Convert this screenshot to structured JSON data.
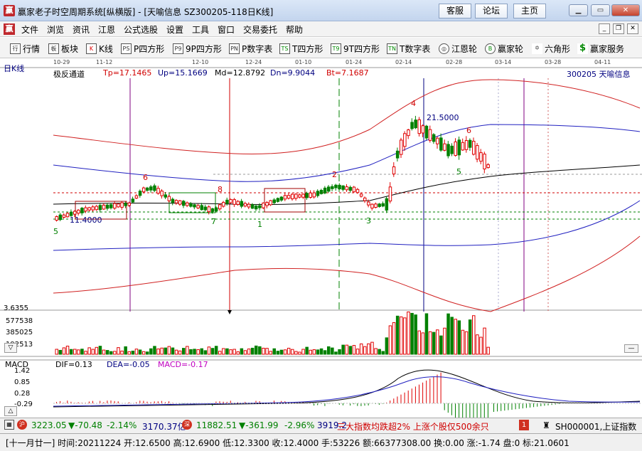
{
  "window": {
    "title": "赢家老子时空周期系统[纵横版] - [天喻信息  SZ300205-118日K线]",
    "app_icon": "赢",
    "top_buttons": [
      "客服",
      "论坛",
      "主页"
    ]
  },
  "menu": {
    "items": [
      "文件",
      "浏览",
      "资讯",
      "江恩",
      "公式选股",
      "设置",
      "工具",
      "窗口",
      "交易委托",
      "帮助"
    ]
  },
  "toolbar": {
    "items": [
      {
        "icon": "行",
        "label": "行情"
      },
      {
        "icon": "板",
        "label": "板块"
      },
      {
        "icon": "K",
        "label": "K线"
      },
      {
        "icon": "PS",
        "label": "P四方形"
      },
      {
        "icon": "P9",
        "label": "9P四方形"
      },
      {
        "icon": "PN",
        "label": "P数字表"
      },
      {
        "icon": "TS",
        "label": "T四方形"
      },
      {
        "icon": "T9",
        "label": "9T四方形"
      },
      {
        "icon": "TN",
        "label": "T数字表"
      },
      {
        "icon": "◎",
        "label": "江恩轮"
      },
      {
        "icon": "B",
        "label": "赢家轮"
      },
      {
        "icon": "✡",
        "label": "六角形"
      },
      {
        "icon": "$",
        "label": "赢家服务"
      }
    ]
  },
  "chart_header": {
    "period": "日K线",
    "dates": [
      "10-29",
      "11-12",
      "12-10",
      "12-24",
      "01-10",
      "01-24",
      "02-14",
      "02-28",
      "03-14",
      "03-28",
      "04-11"
    ],
    "indicator": "极反通道",
    "tp": "Tp=17.1465",
    "up": "Up=15.1669",
    "md": "Md=12.8792",
    "dn": "Dn=9.9044",
    "bt": "Bt=7.1687",
    "stock": "300205  天喻信息"
  },
  "annotations": {
    "high_price": "21.5000",
    "low_price": "11.4000",
    "wave_labels": [
      "5",
      "6",
      "8",
      "7",
      "1",
      "2",
      "3",
      "4",
      "6",
      "5"
    ]
  },
  "volume": {
    "top": "3.6355",
    "ticks": [
      "577538",
      "385025",
      "192513"
    ]
  },
  "macd": {
    "title": "MACD",
    "dif": "DIF=0.13",
    "dea": "DEA=-0.05",
    "macd": "MACD=-0.17",
    "ticks": [
      "1.42",
      "0.85",
      "0.28",
      "-0.29"
    ]
  },
  "status1": {
    "sh_index": "3223.05",
    "sh_change": "▼-70.48",
    "sh_pct": "-2.14%",
    "sh_amount": "3170.37亿",
    "sz_index": "11882.51",
    "sz_change": "▼-361.99",
    "sz_pct": "-2.96%",
    "sz_amount": "3919.2",
    "ticker_text": "三大指数均跌超2% 上涨个股仅500余只",
    "page_num": "1",
    "right_text": "SH000001,上证指数"
  },
  "status2": {
    "text": "[十一月廿一] 时间:20211224 开:12.6500 高:12.6900 低:12.3300 收:12.4000 手:53226 额:66377308.00 换:0.00 涨:-1.74 盘:0 标:21.0601"
  },
  "colors": {
    "up": "#e00000",
    "down": "#008000",
    "channel_red": "#d02020",
    "channel_blue": "#2020c0"
  },
  "icons": [
    "app-logo-icon",
    "minimize-icon",
    "restore-icon",
    "close-icon",
    "scroll-down-icon",
    "scroll-up-icon",
    "expand-icon"
  ]
}
